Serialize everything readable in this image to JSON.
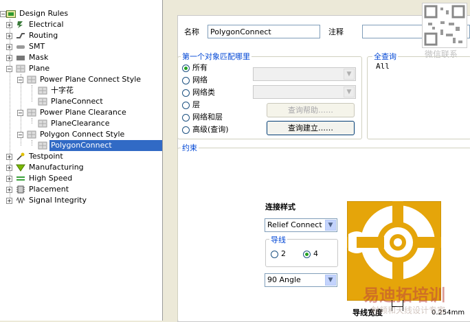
{
  "tree": {
    "root": "Design Rules",
    "items": [
      {
        "label": "Electrical",
        "icon": "electrical-icon"
      },
      {
        "label": "Routing",
        "icon": "routing-icon"
      },
      {
        "label": "SMT",
        "icon": "smt-icon"
      },
      {
        "label": "Mask",
        "icon": "mask-icon"
      },
      {
        "label": "Plane",
        "icon": "plane-icon"
      },
      {
        "label": "Power Plane Connect Style",
        "icon": "rule-icon"
      },
      {
        "label": "十字花",
        "icon": "rule-icon"
      },
      {
        "label": "PlaneConnect",
        "icon": "rule-icon"
      },
      {
        "label": "Power Plane Clearance",
        "icon": "rule-icon"
      },
      {
        "label": "PlaneClearance",
        "icon": "rule-icon"
      },
      {
        "label": "Polygon Connect Style",
        "icon": "rule-icon"
      },
      {
        "label": "PolygonConnect",
        "icon": "rule-icon"
      },
      {
        "label": "Testpoint",
        "icon": "testpoint-icon"
      },
      {
        "label": "Manufacturing",
        "icon": "manufacturing-icon"
      },
      {
        "label": "High Speed",
        "icon": "high-speed-icon"
      },
      {
        "label": "Placement",
        "icon": "placement-icon"
      },
      {
        "label": "Signal Integrity",
        "icon": "signal-integrity-icon"
      }
    ]
  },
  "form": {
    "name_label": "名称",
    "name_value": "PolygonConnect",
    "comment_label": "注释",
    "comment_value": "",
    "match_group": "第一个对象匹配哪里",
    "match_options": [
      "所有",
      "网络",
      "网络类",
      "层",
      "网络和层",
      "高级(查询)"
    ],
    "match_selected": "所有",
    "query_help": "查询帮助……",
    "query_build": "查询建立……",
    "full_query_label": "全查询",
    "full_query_value": "All",
    "constraints_label": "约束",
    "connect_style_label": "连接样式",
    "connect_style_value": "Relief Connect",
    "conductors_label": "导线",
    "conductor_options": [
      "2",
      "4"
    ],
    "conductor_selected": "4",
    "angle_value": "90 Angle",
    "conductor_width_label": "导线宽度",
    "conductor_width_value": "0.254mm"
  },
  "watermarks": {
    "top_right": "微信联系",
    "bottom_brand": "易迪拓培训",
    "bottom_sub": "射频和天线设计专家"
  },
  "colors": {
    "selection": "#316ac5",
    "copper": "#e5a50a",
    "copper_edge": "#b57f00",
    "legend_blue": "#0046d5"
  }
}
